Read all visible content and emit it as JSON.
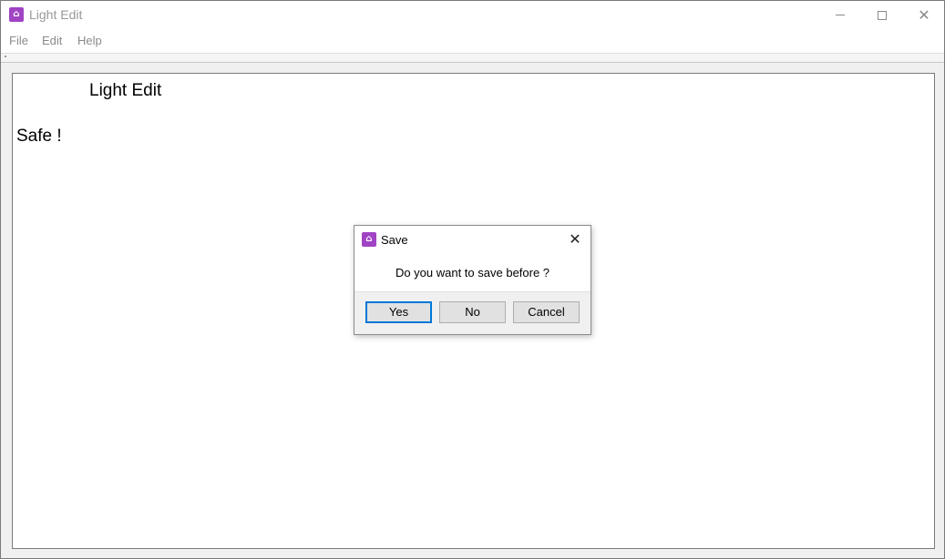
{
  "window": {
    "title": "Light Edit",
    "icon": "app-icon",
    "controls": {
      "minimize": "minimize-icon",
      "maximize": "maximize-icon",
      "close": "✕"
    }
  },
  "menubar": {
    "items": [
      {
        "label": "File"
      },
      {
        "label": "Edit"
      },
      {
        "label": "Help"
      }
    ]
  },
  "document": {
    "heading": "Light Edit",
    "text": "Safe !"
  },
  "dialog": {
    "title": "Save",
    "close_glyph": "✕",
    "message": "Do you want to save before ?",
    "buttons": {
      "yes": "Yes",
      "no": "No",
      "cancel": "Cancel"
    }
  },
  "colors": {
    "accent": "#0078d7",
    "app_icon": "#a044c4"
  }
}
